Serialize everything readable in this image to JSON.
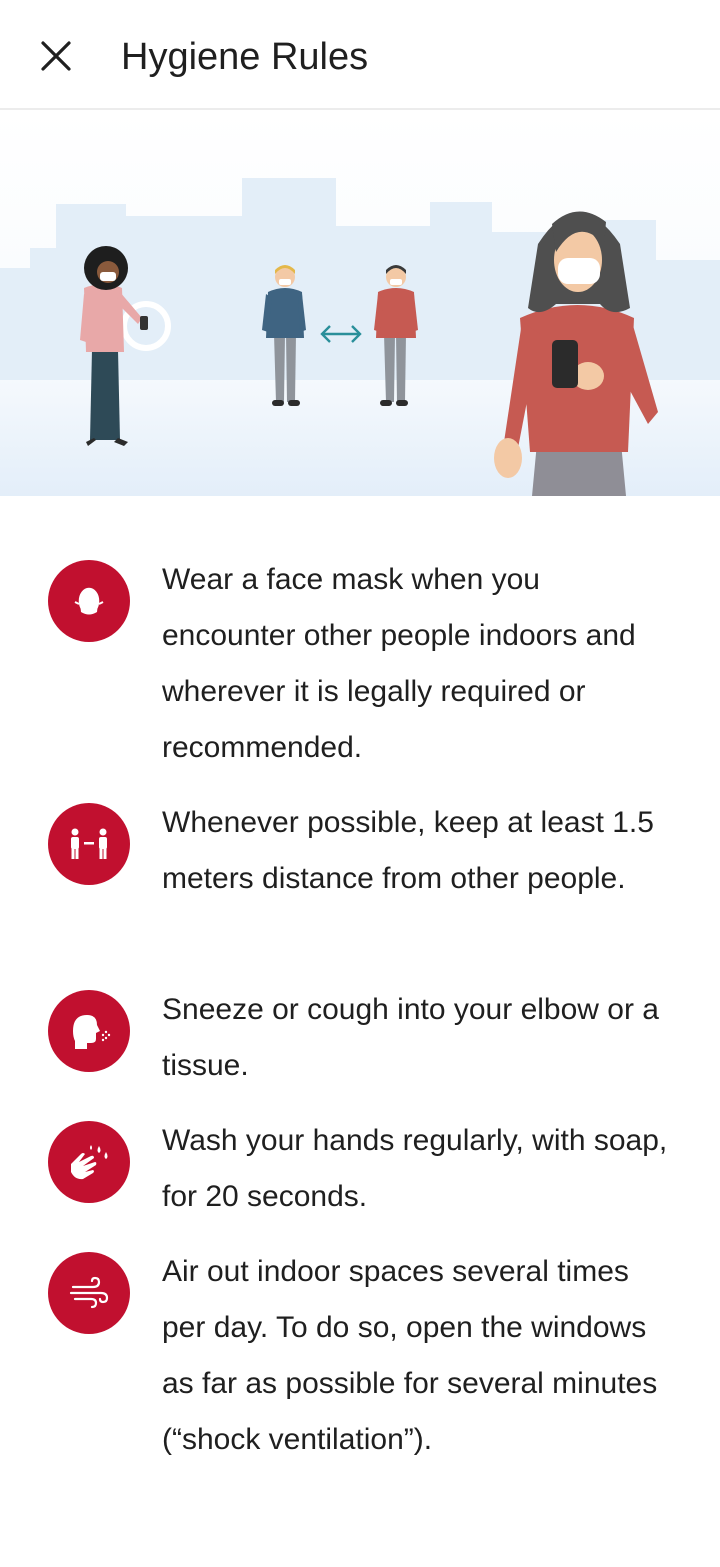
{
  "header": {
    "title": "Hygiene Rules",
    "close_icon": "close-icon"
  },
  "hero": {
    "illustration": "people-social-distancing-with-masks-illustration"
  },
  "rules": [
    {
      "icon": "face-mask-icon",
      "text": "Wear a face mask when you encounter other people indoors and wherever it is legally required or recommended."
    },
    {
      "icon": "distance-icon",
      "text": "Whenever possible, keep at least 1.5 meters distance from other people."
    },
    {
      "icon": "sneeze-icon",
      "text": "Sneeze or cough into your elbow or a tissue."
    },
    {
      "icon": "wash-hands-icon",
      "text": "Wash your hands regularly, with soap, for 20 seconds."
    },
    {
      "icon": "air-ventilation-icon",
      "text": "Air out indoor spaces several times per day. To do so, open the windows as far as possible for several minutes (“shock ventilation”)."
    }
  ],
  "colors": {
    "accent": "#c1102f",
    "hero_background": "#e8f2fb",
    "text": "#1f1f1f"
  }
}
